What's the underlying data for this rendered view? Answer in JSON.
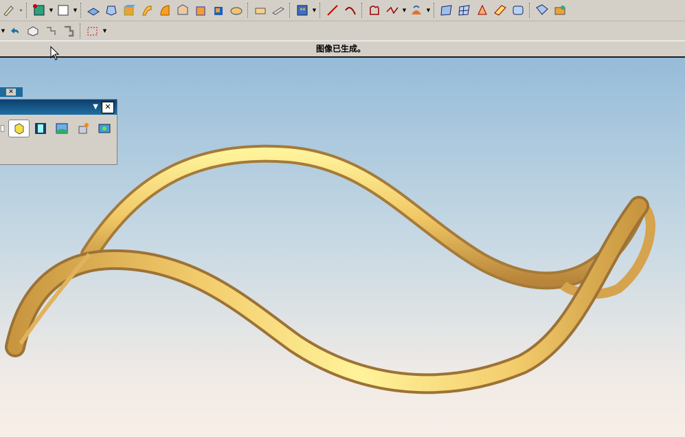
{
  "status_bar": {
    "message": "图像已生成。"
  },
  "toolbar_top": {
    "overflow_label": "»",
    "buttons": [
      "pencil-icon",
      "point-icon",
      "sketch-plane-icon",
      "extrude-icon",
      "revolve-icon",
      "box-icon",
      "swept-icon",
      "shell-icon",
      "blend-icon",
      "block-icon",
      "hole-icon",
      "pad-icon",
      "thicken-icon",
      "offset-face-icon",
      "assembly-icon",
      "line-icon",
      "arc-icon",
      "curve-boundary-icon",
      "spline-icon",
      "surface-analysis-icon",
      "surface-grid-icon",
      "mesh-surface-icon",
      "through-curves-icon",
      "ruled-surface-icon",
      "swoop-surface-icon",
      "face-analysis-icon",
      "view-settings-icon"
    ]
  },
  "toolbar_second": {
    "buttons": [
      "undo-icon",
      "view-orient-icon",
      "snap-point-icon",
      "move-icon",
      "selection-box-icon"
    ]
  },
  "render_dock": {
    "title": "",
    "menu_symbol": "▼",
    "close_symbol": "✕",
    "tab_close_symbol": "✕",
    "buttons": [
      "list-icon",
      "render-style-icon",
      "shaded-cube-icon",
      "background-icon",
      "lighting-icon",
      "visual-effects-icon"
    ]
  },
  "colors": {
    "model_light": "#fff39a",
    "model_mid": "#f3cc6c",
    "model_dark": "#c8963f",
    "title_bar": "#14507f",
    "bg_top": "#96bcd9",
    "bg_bottom": "#f8eee8"
  }
}
